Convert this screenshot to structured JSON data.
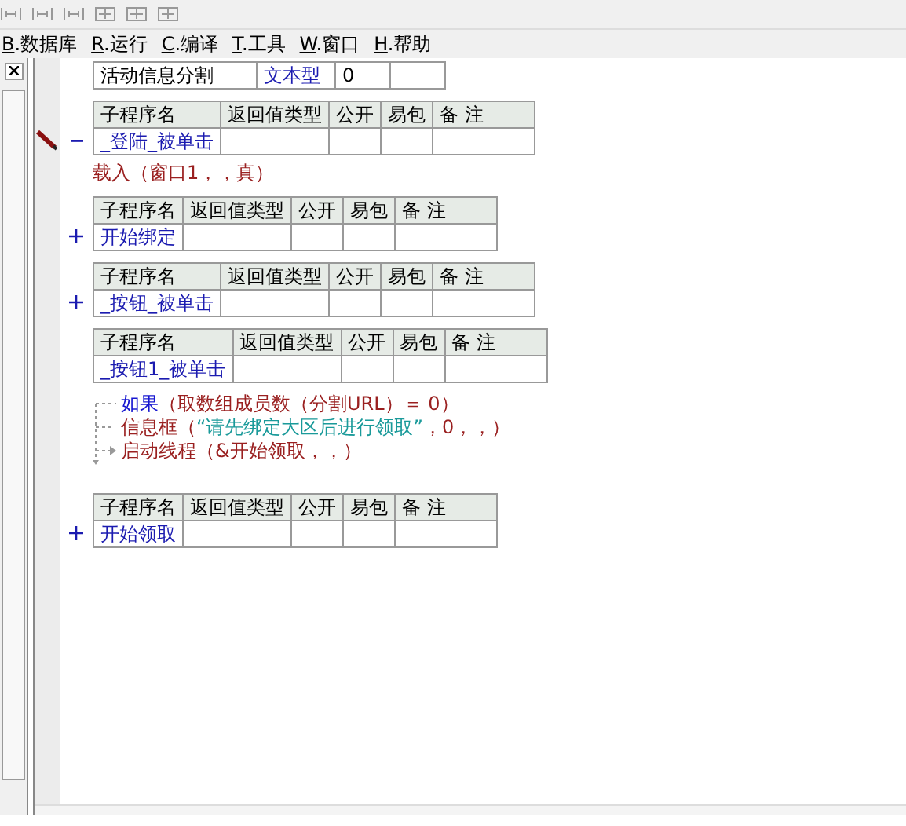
{
  "menu": [
    {
      "label": "B.数据库"
    },
    {
      "label": "R.运行"
    },
    {
      "label": "C.编译"
    },
    {
      "label": "T.工具"
    },
    {
      "label": "W.窗口"
    },
    {
      "label": "H.帮助"
    }
  ],
  "variable": {
    "name": "活动信息分割",
    "type": "文本型",
    "value": "0"
  },
  "subroutines": [
    {
      "header": [
        "子程序名",
        "返回值类型",
        "公开",
        "易包",
        "备 注"
      ],
      "name": "_登陆_被单击",
      "expanded": true,
      "current": true,
      "code": [
        {
          "segments": [
            {
              "text": "载入（窗口1，，真）",
              "kind": "command"
            }
          ]
        }
      ]
    },
    {
      "header": [
        "子程序名",
        "返回值类型",
        "公开",
        "易包",
        "备 注"
      ],
      "name": "开始绑定",
      "expanded": false,
      "current": false
    },
    {
      "header": [
        "子程序名",
        "返回值类型",
        "公开",
        "易包",
        "备 注"
      ],
      "name": "_按钮_被单击",
      "expanded": false,
      "current": false
    },
    {
      "header": [
        "子程序名",
        "返回值类型",
        "公开",
        "易包",
        "备 注"
      ],
      "name": "_按钮1_被单击",
      "current": false,
      "flow": true,
      "code": [
        {
          "segments": [
            {
              "text": "如果",
              "kind": "keyword"
            },
            {
              "text": "（取数组成员数（分割URL）＝ 0）",
              "kind": "command"
            }
          ]
        },
        {
          "segments": [
            {
              "text": "信息框（",
              "kind": "command"
            },
            {
              "text": "“请先绑定大区后进行领取”",
              "kind": "string"
            },
            {
              "text": "，0，，）",
              "kind": "command"
            }
          ]
        },
        {
          "segments": [
            {
              "text": "启动线程（&开始领取，，）",
              "kind": "command"
            }
          ]
        }
      ]
    },
    {
      "header": [
        "子程序名",
        "返回值类型",
        "公开",
        "易包",
        "备 注"
      ],
      "name": "开始领取",
      "expanded": false,
      "current": false
    }
  ]
}
